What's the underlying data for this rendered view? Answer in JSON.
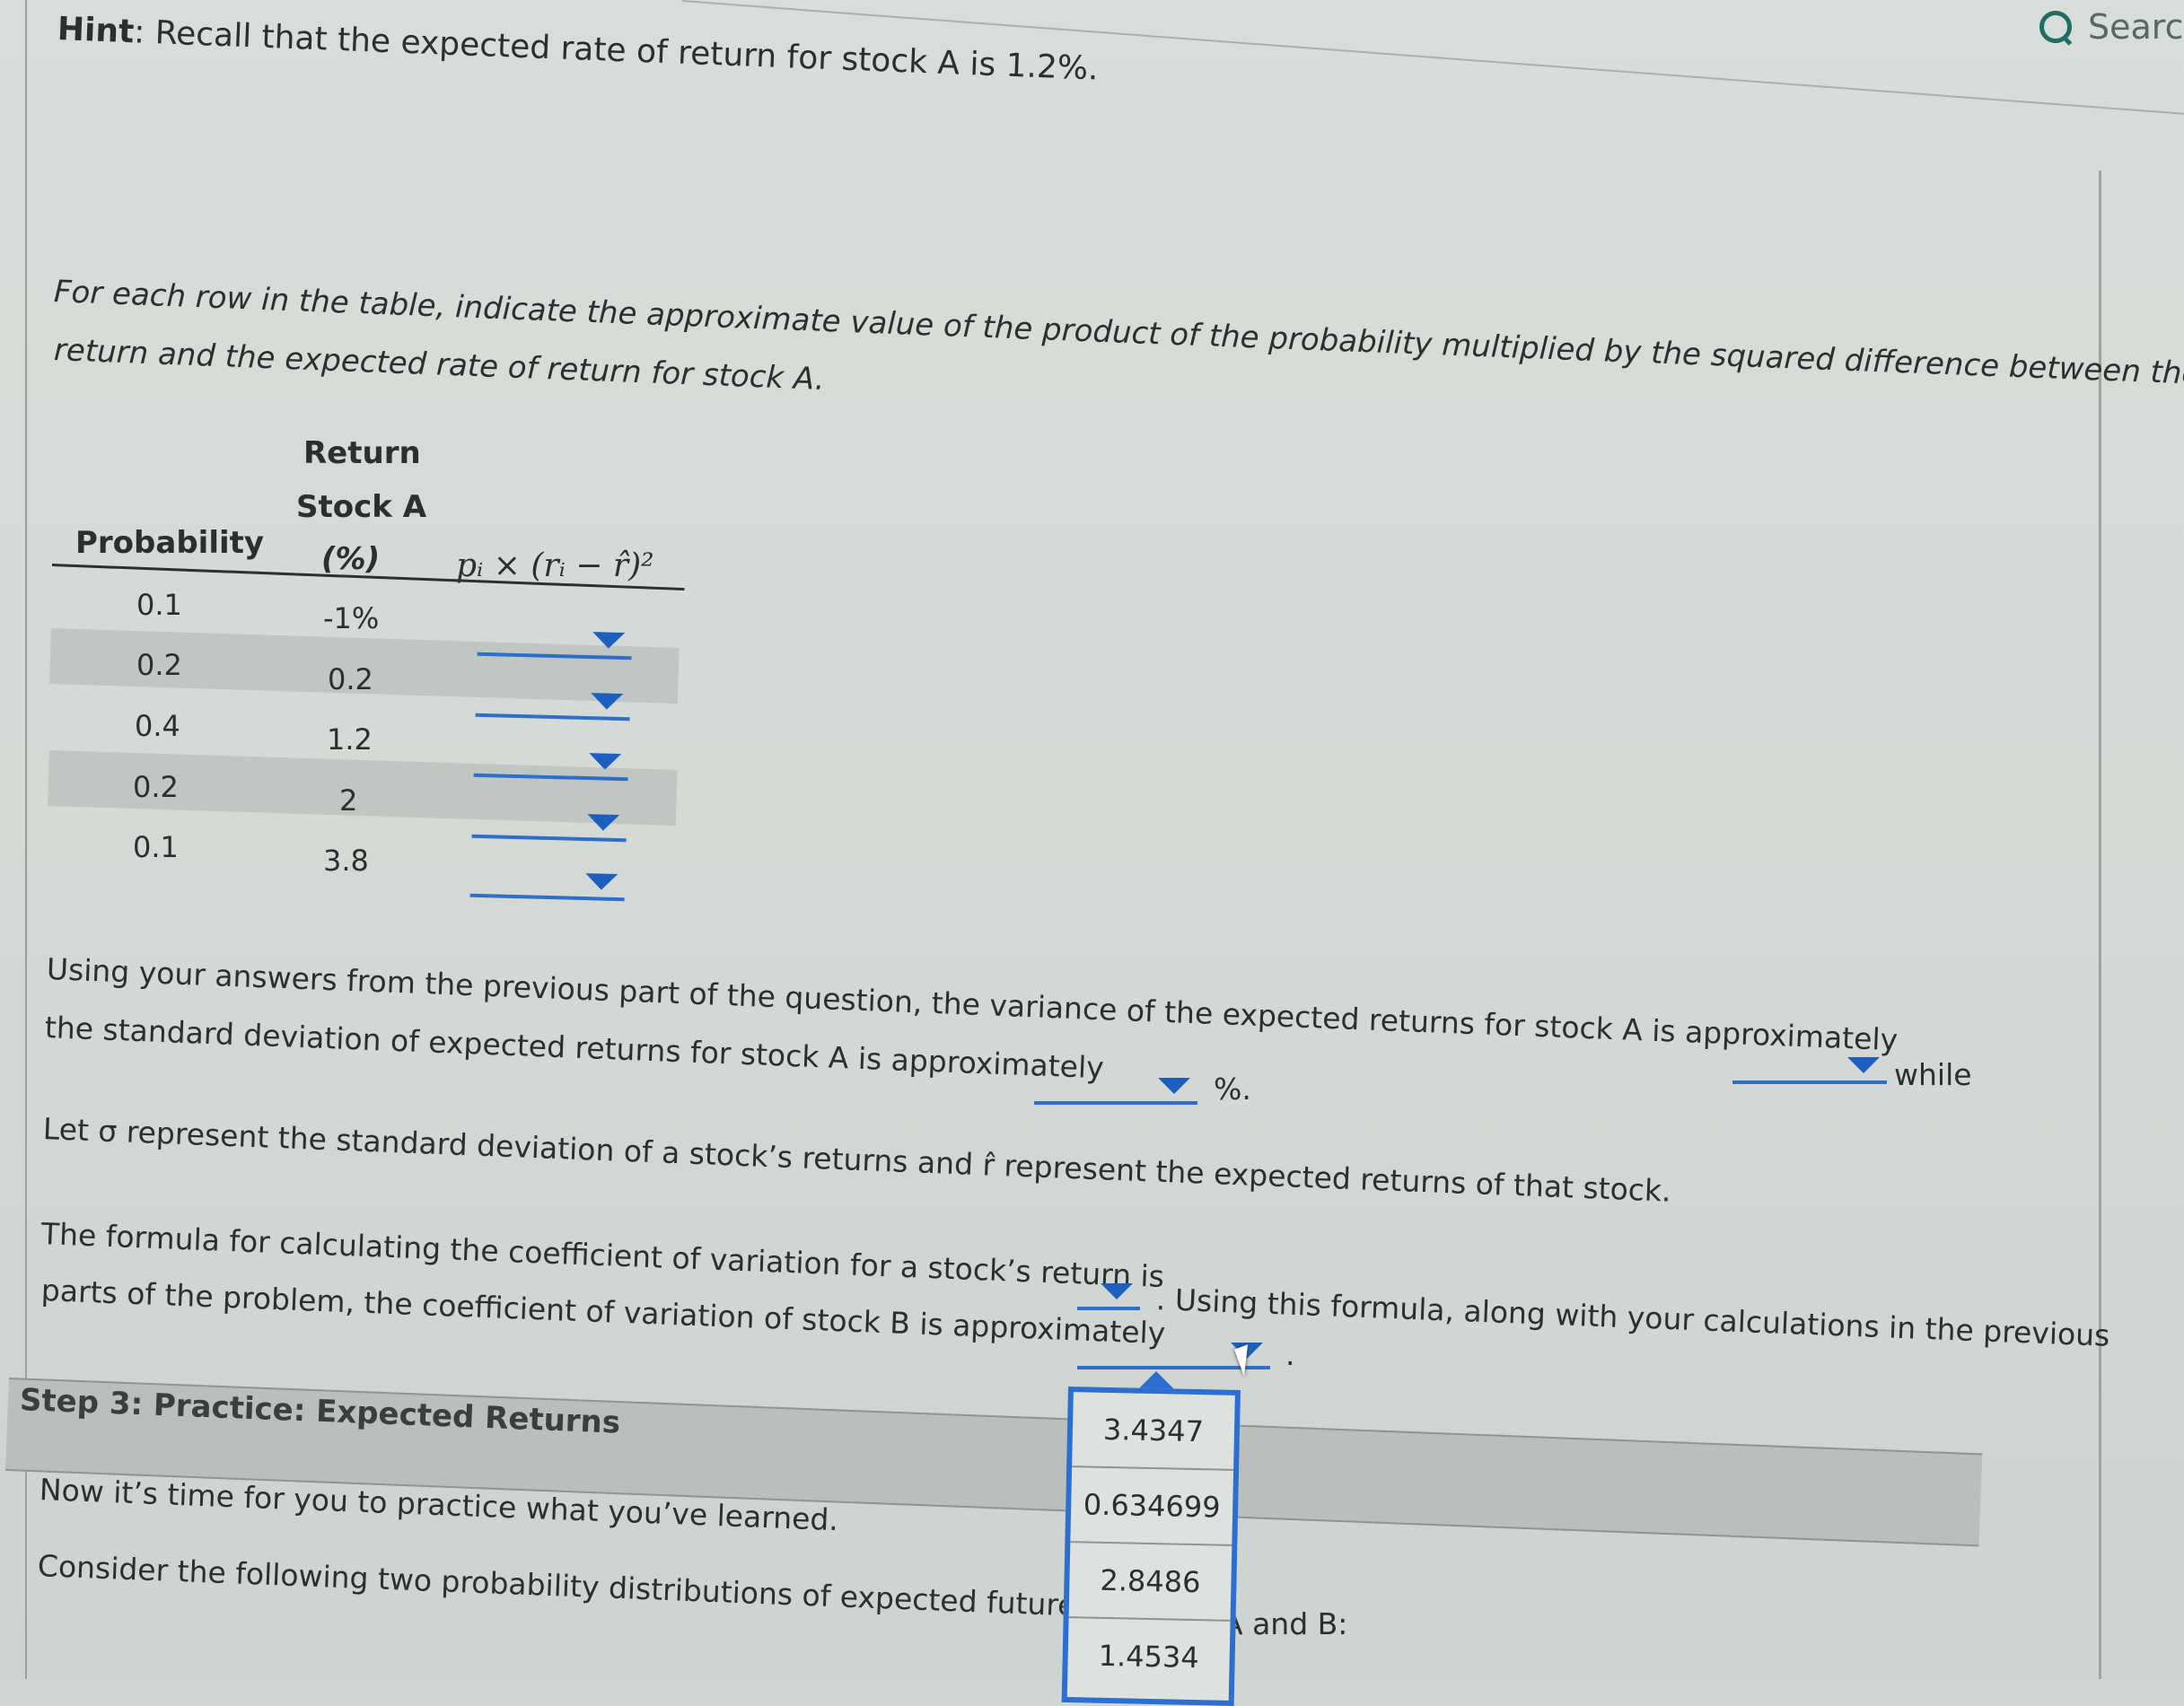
{
  "header": {
    "search_label": "Search"
  },
  "hint": {
    "label": "Hint",
    "text": ": Recall that the expected rate of return for stock A is 1.2%."
  },
  "instructions": {
    "line1": "For each row in the table, indicate the approximate value of the product of the probability multiplied by the squared difference between the rate of",
    "line2": "return and the expected rate of return for stock A."
  },
  "table": {
    "headers": {
      "probability": "Probability",
      "return_line1": "Return",
      "return_line2": "Stock A",
      "return_line3": "(%)",
      "formula": "pᵢ × (rᵢ − r̂)²"
    },
    "rows": [
      {
        "probability": "0.1",
        "return": "-1%"
      },
      {
        "probability": "0.2",
        "return": "0.2"
      },
      {
        "probability": "0.4",
        "return": "1.2"
      },
      {
        "probability": "0.2",
        "return": "2"
      },
      {
        "probability": "0.1",
        "return": "3.8"
      }
    ]
  },
  "variance_question": {
    "line1": "Using your answers from the previous part of the question, the variance of the expected returns for stock A is approximately",
    "while": "while",
    "line2": "the standard deviation of expected returns for stock A is approximately",
    "percent": "%."
  },
  "sigma_note": "Let σ represent the standard deviation of a stock’s returns and r̂ represent the expected returns of that stock.",
  "cv_question": {
    "line1": "The formula for calculating the coefficient of variation for a stock’s return is",
    "line1_cont": ". Using this formula, along with your calculations in the previous",
    "line2": "parts of the problem, the coefficient of variation of stock B is approximately",
    "line2_end": "."
  },
  "step3": {
    "title": "Step 3: Practice: Expected Returns",
    "line1": "Now it’s time for you to practice what you’ve learned.",
    "line2": "Consider the following two probability distributions of expected future returns",
    "line2_end": "A and B:"
  },
  "dropdown_options": [
    "3.4347",
    "0.634699",
    "2.8486",
    "1.4534"
  ]
}
